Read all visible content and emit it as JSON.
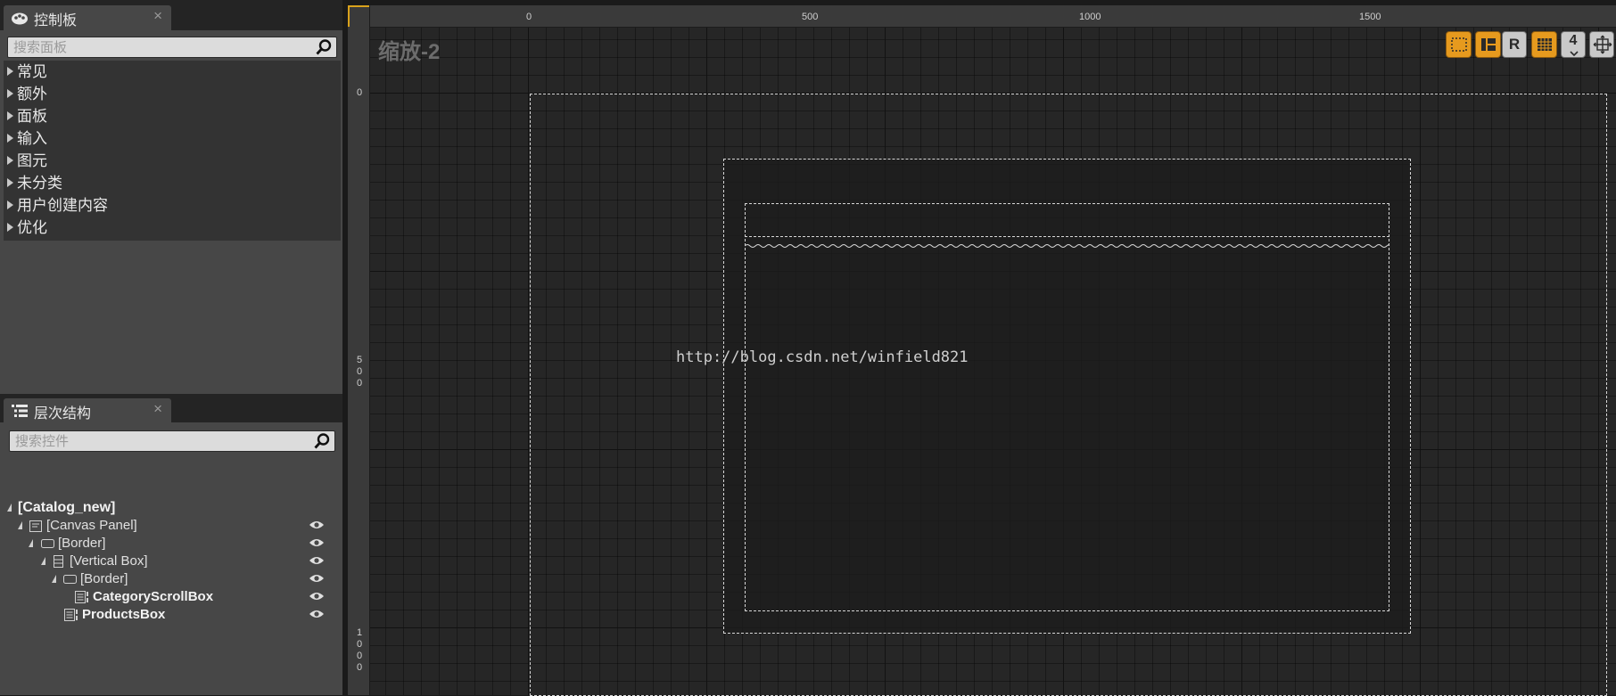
{
  "palette": {
    "tab_title": "控制板",
    "search_placeholder": "搜索面板",
    "categories": [
      "常见",
      "额外",
      "面板",
      "输入",
      "图元",
      "未分类",
      "用户创建内容",
      "优化"
    ]
  },
  "hierarchy": {
    "tab_title": "层次结构",
    "search_placeholder": "搜索控件",
    "items": [
      {
        "label": "[Catalog_new]"
      },
      {
        "label": "[Canvas Panel]"
      },
      {
        "label": "[Border]"
      },
      {
        "label": "[Vertical Box]"
      },
      {
        "label": "[Border]"
      },
      {
        "label": "CategoryScrollBox"
      },
      {
        "label": "ProductsBox"
      }
    ]
  },
  "designer": {
    "zoom_label": "缩放-2",
    "ruler_h": [
      "0",
      "500",
      "1000",
      "1500"
    ],
    "ruler_v": [
      "0",
      "5\n0\n0",
      "1\n0\n0\n0"
    ],
    "watermark": "http://blog.csdn.net/winfield821",
    "toolbar": {
      "r_label": "R",
      "num_label": "4"
    }
  },
  "colors": {
    "accent": "#e69a1e",
    "panel_bg": "#474747",
    "canvas_bg": "#262626"
  }
}
